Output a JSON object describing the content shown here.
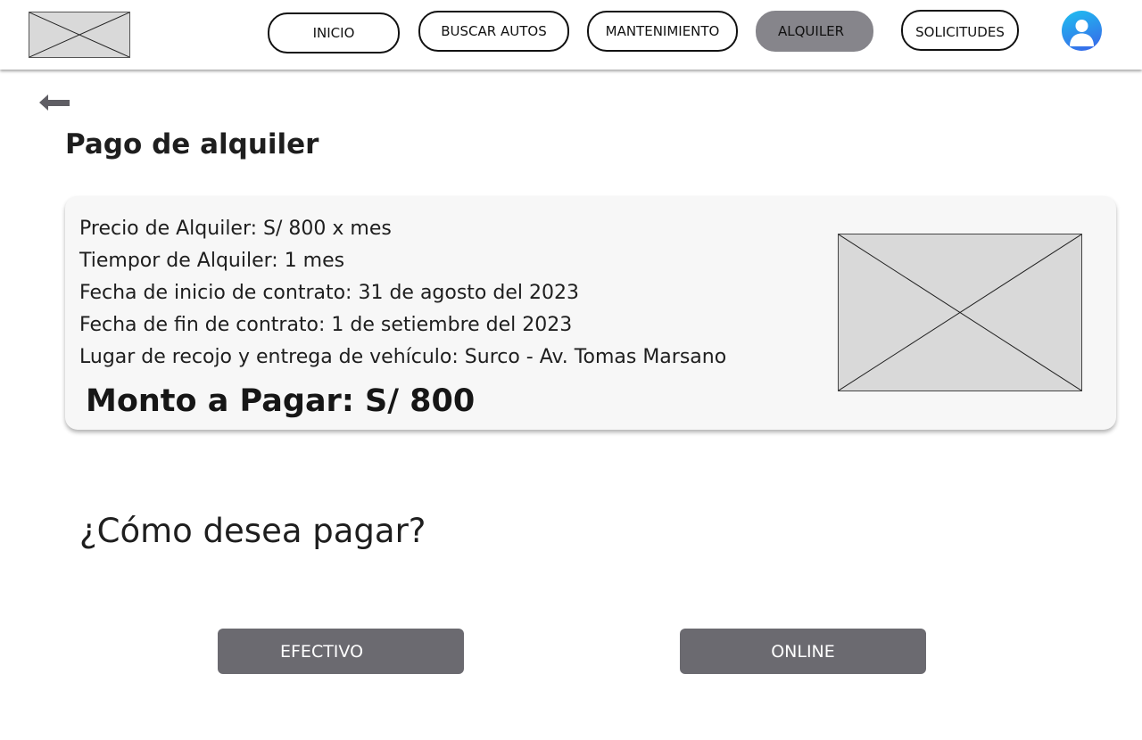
{
  "header": {
    "logo_icon": "image-placeholder-icon",
    "nav": [
      {
        "label": "INICIO"
      },
      {
        "label": "BUSCAR AUTOS"
      },
      {
        "label": "MANTENIMIENTO"
      },
      {
        "label": "ALQUILER"
      },
      {
        "label": "SOLICITUDES"
      }
    ],
    "active_nav": "ALQUILER",
    "avatar_icon": "user-avatar-icon"
  },
  "back_icon": "arrow-left-icon",
  "page": {
    "title": "Pago de alquiler"
  },
  "summary": {
    "lines": [
      " Precio de Alquiler:  S/ 800 x mes",
      "Tiempor de Alquiler: 1 mes",
      "Fecha de inicio de contrato: 31 de agosto del 2023",
      "Fecha de fin de contrato: 1 de setiembre del 2023",
      "Lugar de recojo y entrega de vehículo: Surco - Av. Tomas Marsano"
    ],
    "total": "Monto a Pagar:  S/ 800",
    "image_icon": "image-placeholder-icon"
  },
  "payment": {
    "question": "¿Cómo desea pagar?",
    "cash_label": "EFECTIVO",
    "online_label": "ONLINE"
  },
  "colors": {
    "active_nav": "#86858b",
    "button": "#6b6a70",
    "card": "#f7f7f7",
    "placeholder": "#d9d9d9"
  }
}
